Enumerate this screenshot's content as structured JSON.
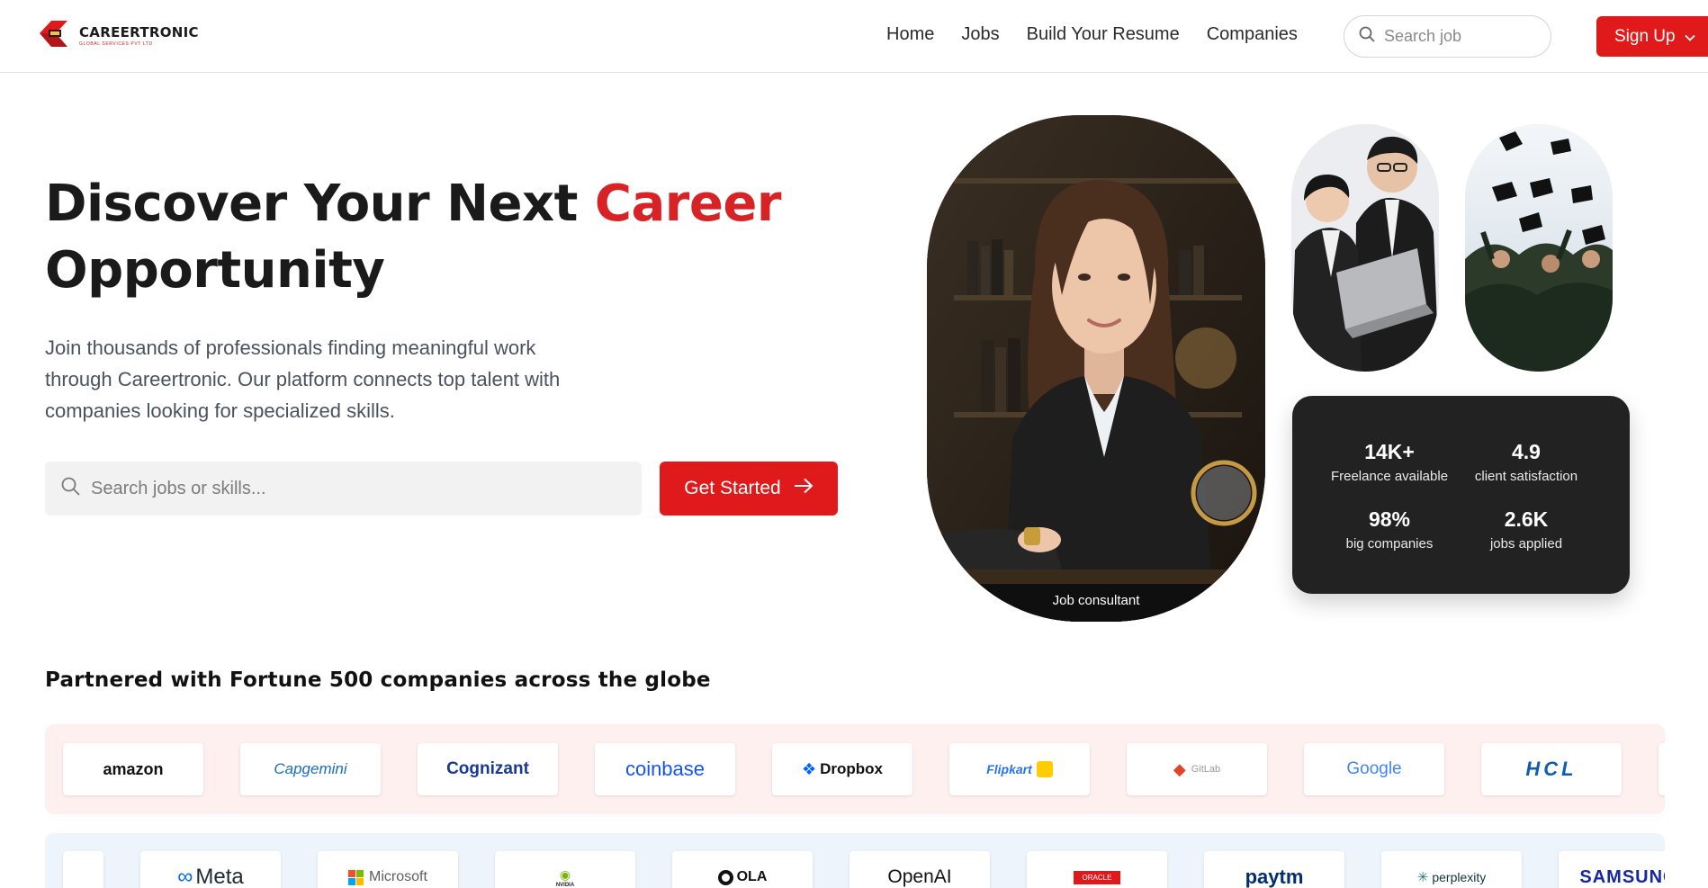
{
  "brand": {
    "name": "CAREERTRONIC",
    "tagline": "GLOBAL SERVICES PVT LTD",
    "accent_color": "#e0191b"
  },
  "nav": {
    "links": [
      "Home",
      "Jobs",
      "Build Your Resume",
      "Companies"
    ],
    "search_placeholder": "Search job",
    "signup_label": "Sign Up",
    "signup_icon": "chevron-down-icon"
  },
  "hero": {
    "title_part1": "Discover Your Next ",
    "title_accent": "Career",
    "title_part2": "Opportunity",
    "description": "Join thousands of professionals finding meaningful work through Careertronic. Our platform connects top talent with companies looking for specialized skills.",
    "search_placeholder": "Search jobs or skills...",
    "cta_label": "Get Started",
    "cta_icon": "arrow-right-icon",
    "photo_caption": "Job consultant"
  },
  "stats": [
    {
      "value": "14K+",
      "label": "Freelance available"
    },
    {
      "value": "4.9",
      "label": "client satisfaction"
    },
    {
      "value": "98%",
      "label": "big companies"
    },
    {
      "value": "2.6K",
      "label": "jobs applied"
    }
  ],
  "partners": {
    "title": "Partnered with Fortune 500 companies across the globe",
    "row1": [
      "amazon",
      "Capgemini",
      "Cognizant",
      "coinbase",
      "Dropbox",
      "Flipkart",
      "GitLab",
      "Google",
      "HCL"
    ],
    "row2": [
      "Meta",
      "Microsoft",
      "NVIDIA",
      "OLA",
      "OpenAI",
      "ORACLE",
      "paytm",
      "perplexity",
      "SAMSUNG"
    ]
  }
}
